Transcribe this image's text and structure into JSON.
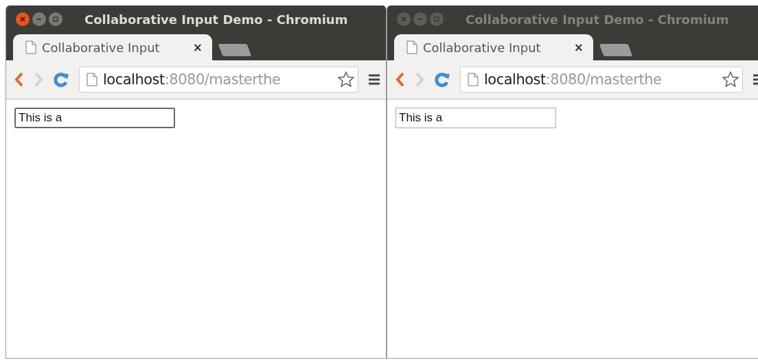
{
  "windows": [
    {
      "active": true,
      "title": "Collaborative Input Demo - Chromium",
      "tab": {
        "title": "Collaborative Input",
        "close": "×",
        "selected": true
      },
      "address": {
        "host": "localhost",
        "path": ":8080/masterthe"
      },
      "input": {
        "value": "This is a",
        "focused": true
      }
    },
    {
      "active": false,
      "title": "Collaborative Input Demo - Chromium",
      "tab": {
        "title": "Collaborative Input",
        "close": "×",
        "selected": true
      },
      "address": {
        "host": "localhost",
        "path": ":8080/masterthe"
      },
      "input": {
        "value": "This is a",
        "focused": false
      }
    }
  ]
}
